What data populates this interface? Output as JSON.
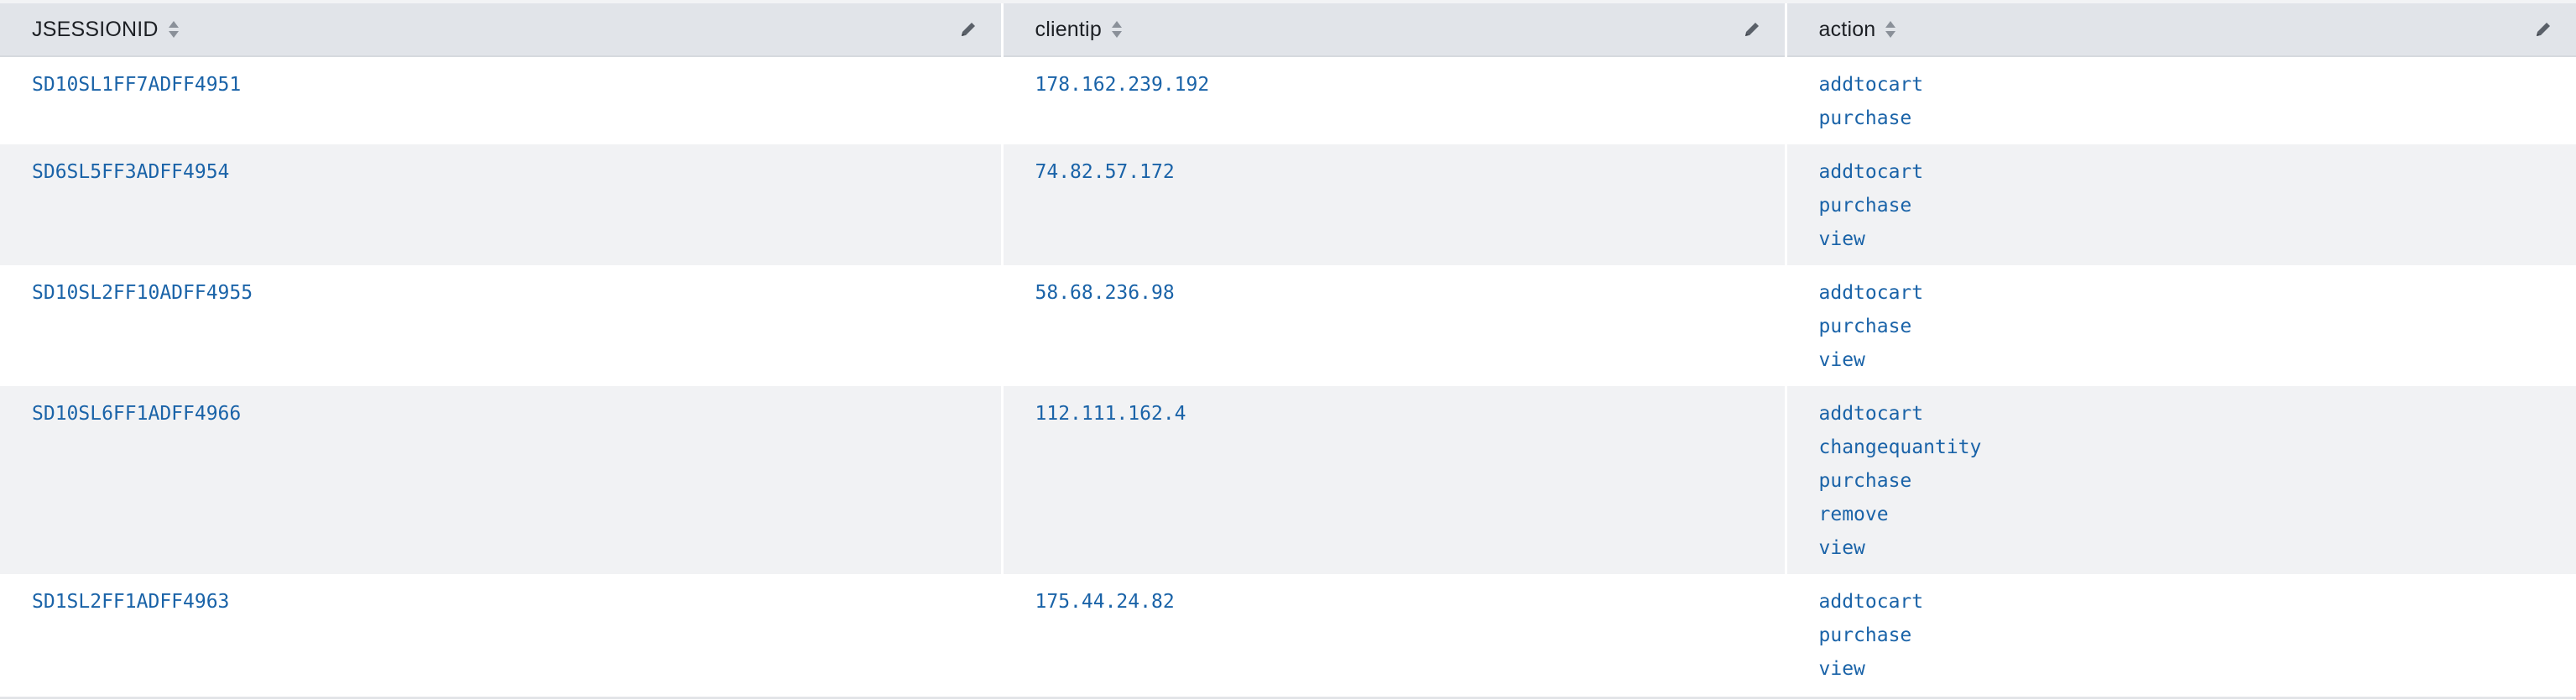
{
  "table": {
    "columns": [
      {
        "label": "JSESSIONID"
      },
      {
        "label": "clientip"
      },
      {
        "label": "action"
      }
    ],
    "rows": [
      {
        "jsessionid": "SD10SL1FF7ADFF4951",
        "clientip": "178.162.239.192",
        "actions": [
          "addtocart",
          "purchase"
        ]
      },
      {
        "jsessionid": "SD6SL5FF3ADFF4954",
        "clientip": "74.82.57.172",
        "actions": [
          "addtocart",
          "purchase",
          "view"
        ]
      },
      {
        "jsessionid": "SD10SL2FF10ADFF4955",
        "clientip": "58.68.236.98",
        "actions": [
          "addtocart",
          "purchase",
          "view"
        ]
      },
      {
        "jsessionid": "SD10SL6FF1ADFF4966",
        "clientip": "112.111.162.4",
        "actions": [
          "addtocart",
          "changequantity",
          "purchase",
          "remove",
          "view"
        ]
      },
      {
        "jsessionid": "SD1SL2FF1ADFF4963",
        "clientip": "175.44.24.82",
        "actions": [
          "addtocart",
          "purchase",
          "view"
        ]
      }
    ]
  },
  "colors": {
    "header_bg": "#e1e4e9",
    "link": "#1a63a8",
    "row_alt": "#f1f2f4"
  },
  "icons": {
    "sort": "sort-icon",
    "edit": "pencil-icon"
  }
}
